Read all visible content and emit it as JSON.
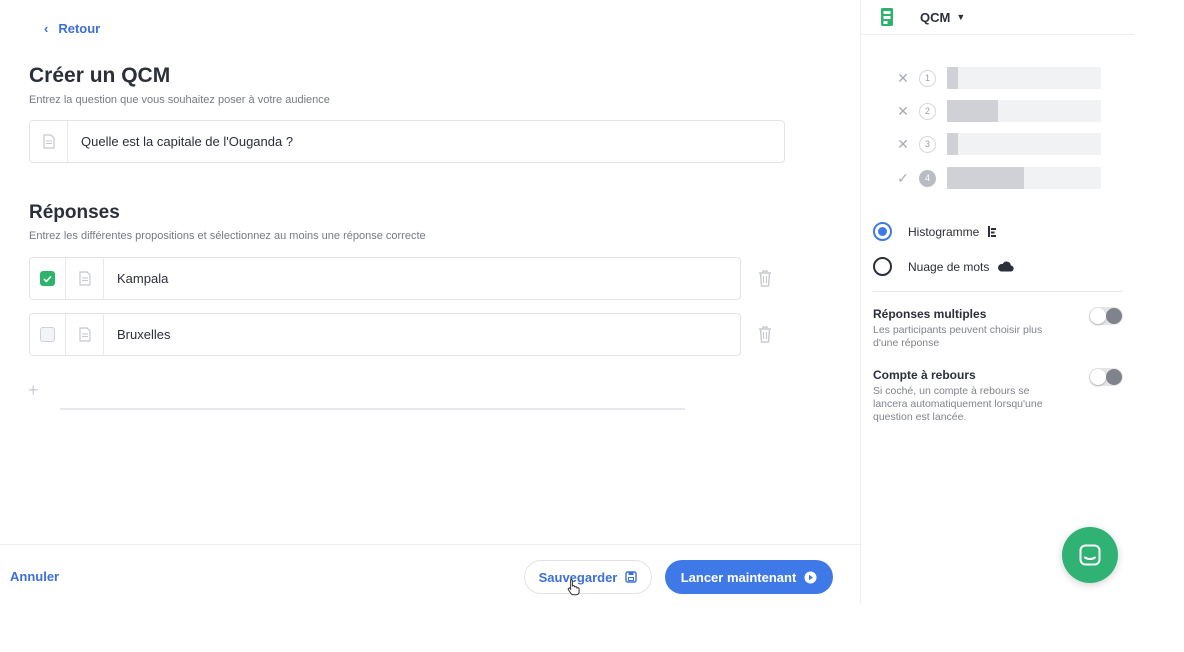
{
  "nav": {
    "back_label": "Retour"
  },
  "question": {
    "title": "Créer un QCM",
    "subtitle": "Entrez la question que vous souhaitez poser à votre audience",
    "value": "Quelle est la capitale de l'Ouganda ?"
  },
  "answers": {
    "title": "Réponses",
    "subtitle": "Entrez les différentes propositions et sélectionnez au moins une réponse correcte",
    "items": [
      {
        "value": "Kampala",
        "correct": true
      },
      {
        "value": "Bruxelles",
        "correct": false
      }
    ],
    "add_label": "+"
  },
  "footer": {
    "cancel_label": "Annuler",
    "save_label": "Sauvegarder",
    "launch_label": "Lancer maintenant"
  },
  "panel": {
    "type_label": "QCM",
    "preview_rows": [
      {
        "num": "1",
        "mark": "✕",
        "level": 0.07,
        "correct": false
      },
      {
        "num": "2",
        "mark": "✕",
        "level": 0.33,
        "correct": false
      },
      {
        "num": "3",
        "mark": "✕",
        "level": 0.07,
        "correct": false
      },
      {
        "num": "4",
        "mark": "✓",
        "level": 0.5,
        "correct": true
      }
    ],
    "display_options": [
      {
        "label": "Histogramme",
        "icon": "bar-chart-icon",
        "selected": true
      },
      {
        "label": "Nuage de mots",
        "icon": "cloud-icon",
        "selected": false
      }
    ],
    "multiple": {
      "title": "Réponses multiples",
      "desc": "Les participants peuvent choisir plus d'une réponse",
      "enabled": false
    },
    "countdown": {
      "title": "Compte à rebours",
      "desc": "Si coché, un compte à rebours se lancera automatiquement lorsqu'une question est lancée.",
      "enabled": false
    }
  },
  "colors": {
    "accent": "#3f79e8",
    "link": "#3c6fd9",
    "correct": "#2db36b",
    "chat": "#2fb274"
  }
}
